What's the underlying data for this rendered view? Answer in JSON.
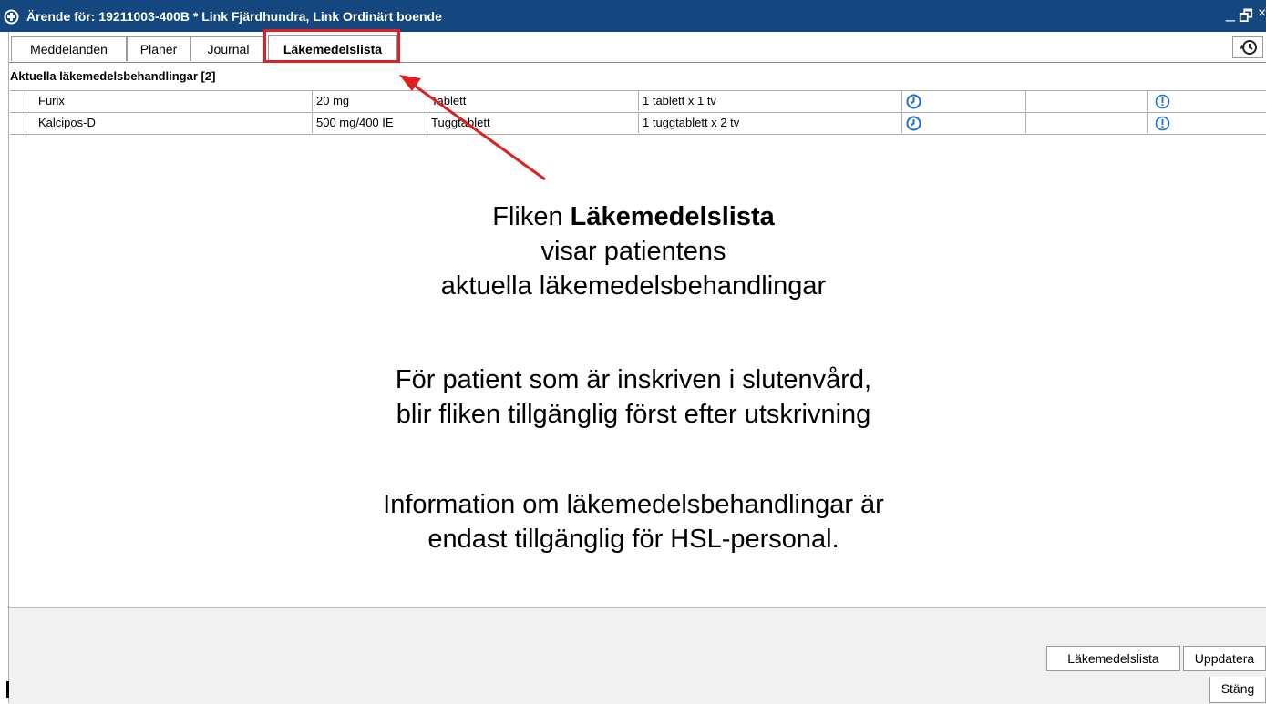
{
  "window": {
    "title": "Ärende för: 19211003-400B * Link Fjärdhundra, Link Ordinärt boende",
    "minimize": "_",
    "restore": "🗗",
    "close": "×"
  },
  "tabs": [
    {
      "label": "Meddelanden",
      "active": false
    },
    {
      "label": "Planer",
      "active": false
    },
    {
      "label": "Journal",
      "active": false
    },
    {
      "label": "Läkemedelslista",
      "active": true
    }
  ],
  "section": {
    "title": "Aktuella läkemedelsbehandlingar",
    "count": "[2]"
  },
  "medications": [
    {
      "name": "Furix",
      "dose": "20 mg",
      "form": "Tablett",
      "dosage": "1 tablett x 1 tv"
    },
    {
      "name": "Kalcipos-D",
      "dose": "500 mg/400 IE",
      "form": "Tuggtablett",
      "dosage": "1 tuggtablett x 2 tv"
    }
  ],
  "annotation": {
    "line1_prefix": "Fliken ",
    "line1_bold": "Läkemedelslista",
    "line2": "visar patientens",
    "line3": "aktuella läkemedelsbehandlingar",
    "line4": "För patient som är inskriven i slutenvård,",
    "line5": "blir fliken tillgänglig först efter utskrivning",
    "line6": "Information om läkemedelsbehandlingar är",
    "line7": "endast tillgänglig för HSL-personal."
  },
  "buttons": {
    "lakemedelslista": "Läkemedelslista",
    "uppdatera": "Uppdatera",
    "stang": "Stäng"
  },
  "colors": {
    "titlebar": "#14477f",
    "icon_blue": "#1a6fd6",
    "highlight_red": "#e02020"
  }
}
